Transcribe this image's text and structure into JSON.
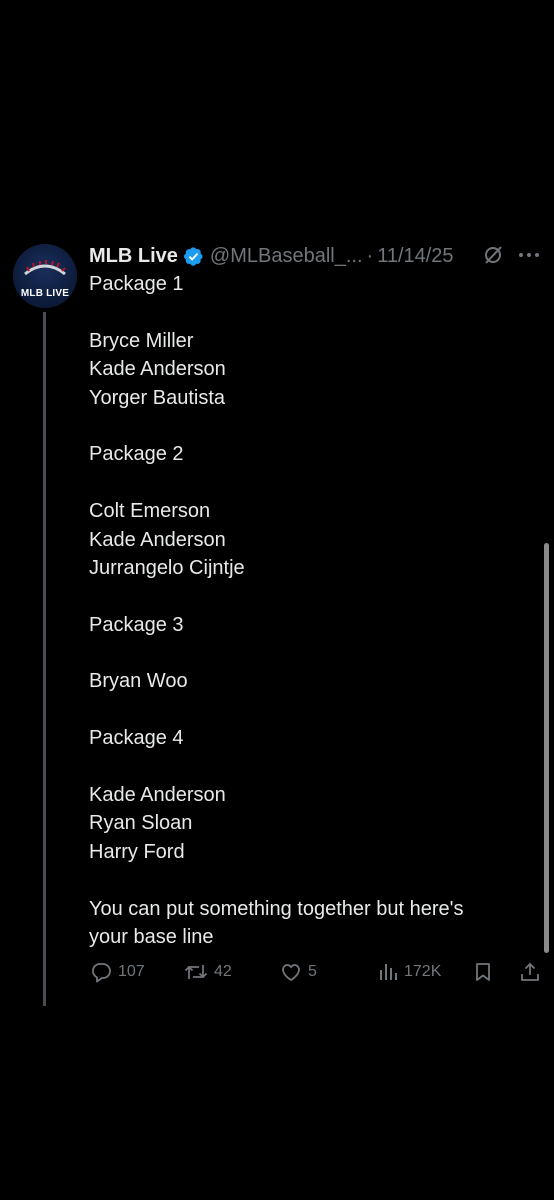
{
  "post": {
    "avatar_label": "MLB LIVE",
    "display_name": "MLB Live",
    "handle": "@MLBaseball_...",
    "separator": "·",
    "date": "11/14/25",
    "verified": true,
    "lines": [
      "Package 1",
      "",
      "Bryce Miller",
      "Kade Anderson",
      "Yorger Bautista",
      "",
      "Package 2",
      "",
      "Colt Emerson",
      "Kade Anderson",
      "Jurrangelo Cijntje",
      "",
      "Package 3",
      "",
      "Bryan Woo",
      "",
      "Package 4",
      "",
      "Kade Anderson",
      "Ryan Sloan",
      "Harry Ford",
      "",
      "You can put something together but here's",
      "your base line"
    ]
  },
  "actions": {
    "replies": "107",
    "reposts": "42",
    "likes": "5",
    "views": "172K"
  },
  "colors": {
    "background": "#000000",
    "text": "#e7e9ea",
    "muted": "#71767b",
    "verified": "#1d9bf0",
    "thread_line": "#4a4d52"
  },
  "icons": {
    "header": [
      "grok-icon",
      "more-icon"
    ],
    "actions": [
      "reply-icon",
      "repost-icon",
      "like-icon",
      "views-icon",
      "bookmark-icon",
      "share-icon"
    ]
  }
}
